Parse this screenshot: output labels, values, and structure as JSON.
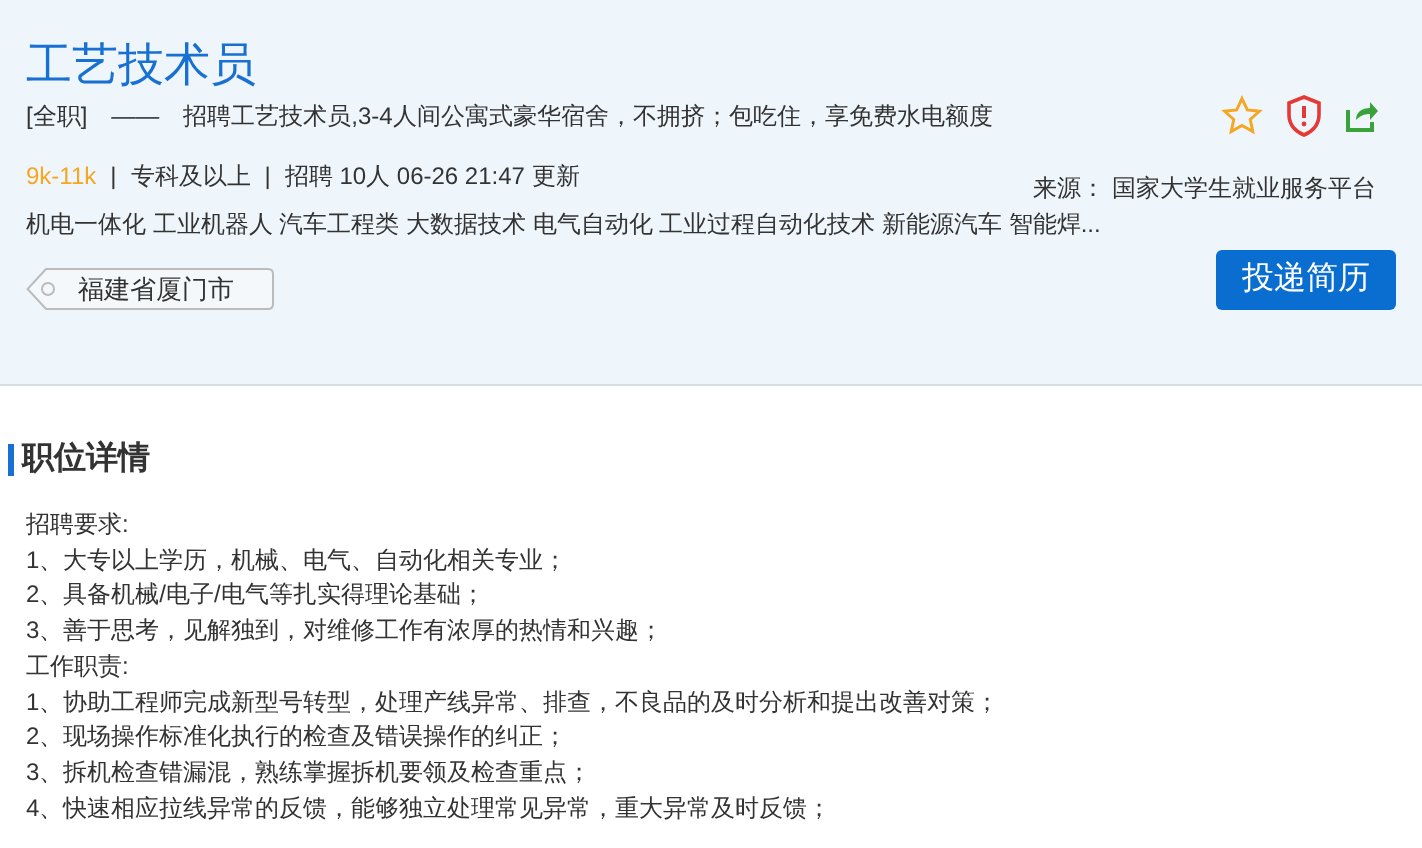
{
  "job": {
    "title": "工艺技术员",
    "type": "[全职]",
    "dash": "——",
    "summary": "招聘工艺技术员,3-4人间公寓式豪华宿舍，不拥挤；包吃住，享免费水电额度",
    "meta": [
      {
        "kind": "salary",
        "text": "9k-11k"
      },
      {
        "kind": "plain",
        "text": "专科及以上"
      },
      {
        "kind": "plain",
        "text": "招聘 10人  06-26 21:47 更新"
      }
    ],
    "separator": "|",
    "tags": "机电一体化 工业机器人 汽车工程类 大数据技术 电气自动化 工业过程自动化技术 新能源汽车 智能焊...",
    "location": "福建省厦门市",
    "source": "来源： 国家大学生就业服务平台",
    "apply_button": "投递简历"
  },
  "details": {
    "heading": "职位详情",
    "lines": [
      "招聘要求:",
      "1、大专以上学历，机械、电气、自动化相关专业；",
      "2、具备机械/电子/电气等扎实得理论基础；",
      "3、善于思考，见解独到，对维修工作有浓厚的热情和兴趣；",
      "工作职责:",
      "1、协助工程师完成新型号转型，处理产线异常、排查，不良品的及时分析和提出改善对策；",
      "2、现场操作标准化执行的检查及错误操作的纠正；",
      "3、拆机检查错漏混，熟练掌握拆机要领及检查重点；",
      "4、快速相应拉线异常的反馈，能够独立处理常见异常，重大异常及时反馈；"
    ]
  }
}
